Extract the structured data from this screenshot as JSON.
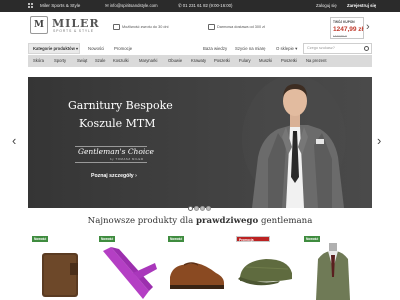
{
  "topbar": {
    "brand": "Miler Sports & Style",
    "email": "info@spiritsandstyle.com",
    "phone": "01 231 61 82 (9:00-16:00)",
    "login": "Zaloguj się",
    "register": "Zarejestruj się"
  },
  "header": {
    "logo_name": "MILER",
    "logo_tagline": "SPORTS & STYLE",
    "feature_1": "Możliwość zwrotu do 30 dni",
    "feature_2": "Darmowa dostawa od 300 zł",
    "promo_tag": "TWÓJ KUPON",
    "promo_price": "1247,99 zł",
    "promo_old_price": "1447,99 zł"
  },
  "nav": {
    "categories_button": "Kategorie produktów",
    "links": [
      "Nowości",
      "Promocje",
      "Baza wiedzy",
      "Szycie na miarę",
      "O sklepie"
    ],
    "search_placeholder": "Czego szukasz?"
  },
  "categories": [
    "Skóra",
    "Sporty",
    "Swiąt",
    "Szale",
    "Koszulki",
    "Marynarki",
    "Obuwie",
    "Krawaty",
    "Poszetki",
    "Fulary",
    "Muszki",
    "Poszetki",
    "Na prezent"
  ],
  "hero": {
    "title_line_1": "Garnitury Bespoke",
    "title_line_2": "Koszule MTM",
    "brand": "Gentleman's Choice",
    "brand_sub": "by TOMASZ MILER",
    "cta": "Poznaj szczegóły ›"
  },
  "slider": {
    "slides": 4,
    "active": 1
  },
  "products_section": {
    "title_regular": "Najnowsze produkty dla",
    "title_bold": "prawdziwego",
    "title_end": "gentlemana",
    "products": [
      {
        "badge": "Nowość",
        "badge_type": "new",
        "item": "wallet"
      },
      {
        "badge": "Nowość",
        "badge_type": "new",
        "item": "tie"
      },
      {
        "badge": "Nowość",
        "badge_type": "new",
        "item": "shoe"
      },
      {
        "badge": "Promocja",
        "badge_type": "promo",
        "item": "cap"
      },
      {
        "badge": "Nowość",
        "badge_type": "new",
        "item": "jacket"
      }
    ]
  },
  "colors": {
    "topbar_bg": "#2b2b2b",
    "category_bar_bg": "#dadada",
    "hero_bg": "#3b3b3b",
    "price_red": "#c0392b",
    "badge_new": "#3f8c3f",
    "badge_promo": "#bb2222"
  }
}
